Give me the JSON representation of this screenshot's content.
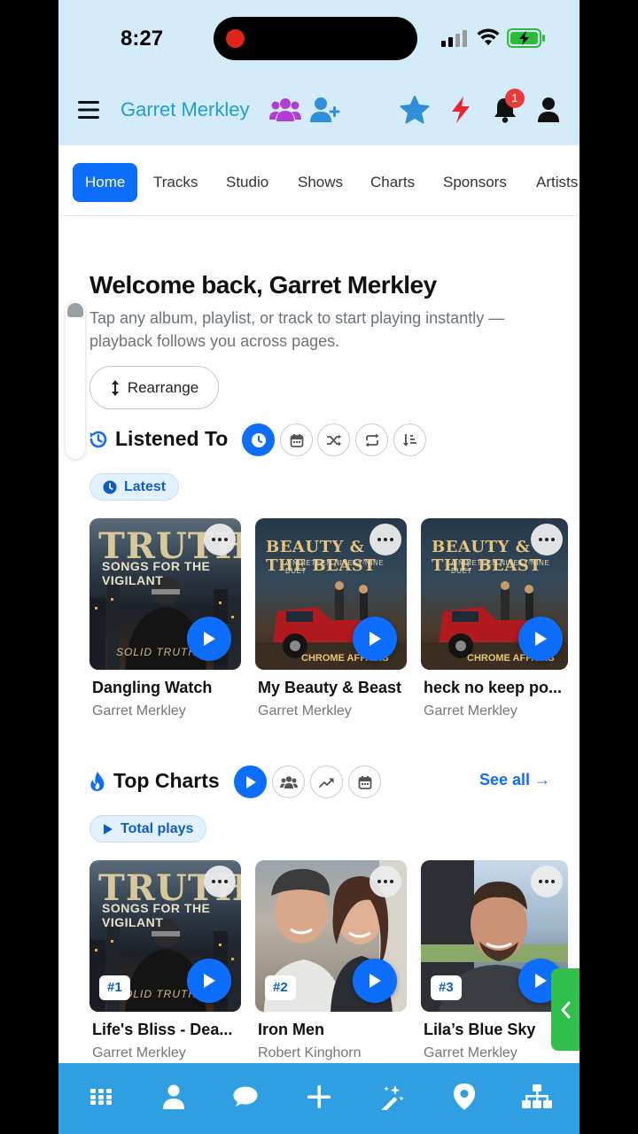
{
  "status": {
    "time": "8:27"
  },
  "header": {
    "user_name": "Garret Merkley",
    "notification_count": "1"
  },
  "tabs": [
    "Home",
    "Tracks",
    "Studio",
    "Shows",
    "Charts",
    "Sponsors",
    "Artists"
  ],
  "active_tab": "Home",
  "welcome": {
    "title": "Welcome back, Garret Merkley",
    "subtitle": "Tap any album, playlist, or track to start playing instantly — playback follows you across pages.",
    "rearrange_label": "Rearrange"
  },
  "listened": {
    "title": "Listened To",
    "filter_chip": "Latest",
    "cards": [
      {
        "title": "Dangling Watch",
        "artist": "Garret Merkley",
        "art_line1": "TRUTH",
        "art_line2": "SONGS FOR THE VIGILANT",
        "art_line3": "SOLID TRUTH"
      },
      {
        "title": "My Beauty & Beast",
        "artist": "Garret Merkley",
        "art_line1": "BEAUTY & THE BEAST",
        "art_line2": "A NINETEEN NINETY-NINE DUET",
        "art_line3": "CHROME AFFAIRS"
      },
      {
        "title": "heck no keep po...",
        "artist": "Garret Merkley",
        "art_line1": "BEAUTY & THE BEAST",
        "art_line2": "A NINETEEN NINETY-NINE DUET",
        "art_line3": "CHROME AFFAIRS"
      }
    ]
  },
  "top_charts": {
    "title": "Top Charts",
    "see_all": "See all →",
    "filter_chip": "Total plays",
    "cards": [
      {
        "rank": "#1",
        "title": "Life's Bliss - Dea...",
        "artist": "Garret Merkley",
        "art_line1": "TRUTH",
        "art_line2": "SONGS FOR THE VIGILANT",
        "art_line3": "SOLID TRUTH"
      },
      {
        "rank": "#2",
        "title": "Iron Men",
        "artist": "Robert Kinghorn"
      },
      {
        "rank": "#3",
        "title": "Lila’s Blue Sky",
        "artist": "Garret Merkley"
      }
    ]
  },
  "colors": {
    "accent": "#0d6efd",
    "header_bg": "#d4ecf9",
    "nav_bg": "#2f9fe2",
    "name_color": "#1e9fd8"
  }
}
